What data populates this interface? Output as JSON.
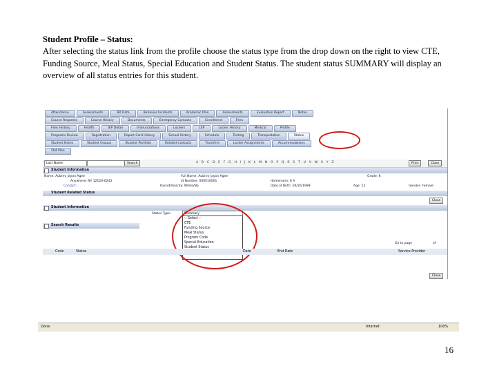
{
  "heading": "Student Profile – Status:",
  "paragraph": "After selecting the status link from the profile choose the status type from the drop down on the right to view CTE, Funding Source, Meal Status, Special Education and Student Status.   The student status SUMMARY will display an overview of all status entries for this student.",
  "page_number": "16",
  "tabs": {
    "row1": [
      "Attendance",
      "Assessments",
      "BR Data",
      "Behavior Incidents",
      "Academic Plan",
      "Assessments",
      "Evaluation Report",
      "Notes"
    ],
    "row2": [
      "Course Requests",
      "Course History",
      "Documents",
      "Emergency Contacts",
      "Enrollment",
      "Fees"
    ],
    "row3": [
      "Fees History",
      "Health",
      "IEP Detail",
      "Immunizations",
      "Lockers",
      "LEP",
      "Locker History",
      "Medical",
      "Profile"
    ],
    "row4": [
      "Programs Review",
      "Registration",
      "Report Card History",
      "School History",
      "Schedule",
      "Testing",
      "Transportation",
      "Status"
    ],
    "row5": [
      "Student Notes",
      "Student Groups",
      "Student Portfolio",
      "Related Contacts",
      "Transfers",
      "Locker Assignments",
      "Accommodations"
    ],
    "row6": [
      "504 Plan"
    ]
  },
  "search": {
    "field": "Last Name",
    "button": "Search",
    "letters": "A B C D E F G H I J K L M N O P Q R S T U V W X Y Z",
    "print": "Print",
    "close": "Close"
  },
  "student_info": {
    "section": "Student Information",
    "name": "Name: Aubrey Jayon Agee",
    "full_name": "Full Name: Aubrey Jayon Agee",
    "grade": "Grade: 6",
    "address": "Anywhere, NY 12120-0243",
    "id": "Id Number: 000010001",
    "homeroom": "Homeroom: 6 A",
    "contact": "Contact:",
    "race": "Race/Ethnicity: White/No",
    "dob": "Date of Birth: 04/20/1999",
    "age": "Age: 12",
    "gender": "Gender: Female"
  },
  "related_status": "Student Related Status",
  "close": "Close",
  "status_section": "Student Information",
  "status_type_label": "Status Type:",
  "status_value": "Summary",
  "dropdown_options": [
    "-- Select --",
    "CTE",
    "Funding Source",
    "Meal Status",
    "Program Code",
    "Special Education",
    "Student Status",
    "Summary"
  ],
  "search_results": "Search Results",
  "pager": {
    "label": "Go to page",
    "of": "of"
  },
  "columns": [
    "Code",
    "Status",
    "Date",
    "End Date",
    "Provider",
    "Service Provider"
  ],
  "browser": {
    "status": "Done",
    "zone": "Internet",
    "zoom": "100%"
  }
}
